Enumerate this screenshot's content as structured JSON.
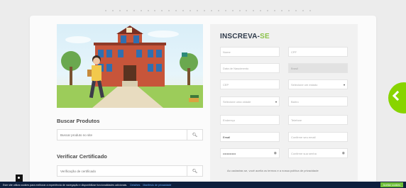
{
  "form": {
    "title_main": "INSCREVA-",
    "title_accent": "SE",
    "nome": "Nome",
    "cpf": "CPF",
    "nascimento": "Data de Nascimento",
    "brasil": "Brasil",
    "cep": "CEP",
    "estado": "Selecione um estado",
    "cidade": "Selecione uma cidade",
    "bairro": "Bairro",
    "endereco": "Endereço",
    "telefone": "Telefone",
    "email": "Email",
    "confirme_email": "Confirme seu email",
    "password_value": "•••••••••••••",
    "confirme_senha": "Confirme sua senha",
    "terms": "Ao cadastrar-se, você aceita os termos e a nossa política de privacidade"
  },
  "buscar": {
    "title": "Buscar Produtos",
    "placeholder": "Buscar produto no site"
  },
  "verificar": {
    "title": "Verificar Certificado",
    "placeholder": "Verificação de certificado"
  },
  "cookie": {
    "text": "Este site utiliza cookies para melhorar a experiência de navegação e disponibilizar funcionalidades adicionais.",
    "link1": "Detalhes",
    "link2": "Manifesto de privacidade",
    "accept": "Aceitar cookies"
  },
  "colors": {
    "accent": "#8bc34a",
    "side_button": "#88d400",
    "cookie_bar": "#0d1f3d"
  },
  "icons": {
    "search": "search-icon",
    "eye": "eye-icon",
    "caret": "chevron-down-icon",
    "side_arrow": "chevron-left-icon"
  }
}
